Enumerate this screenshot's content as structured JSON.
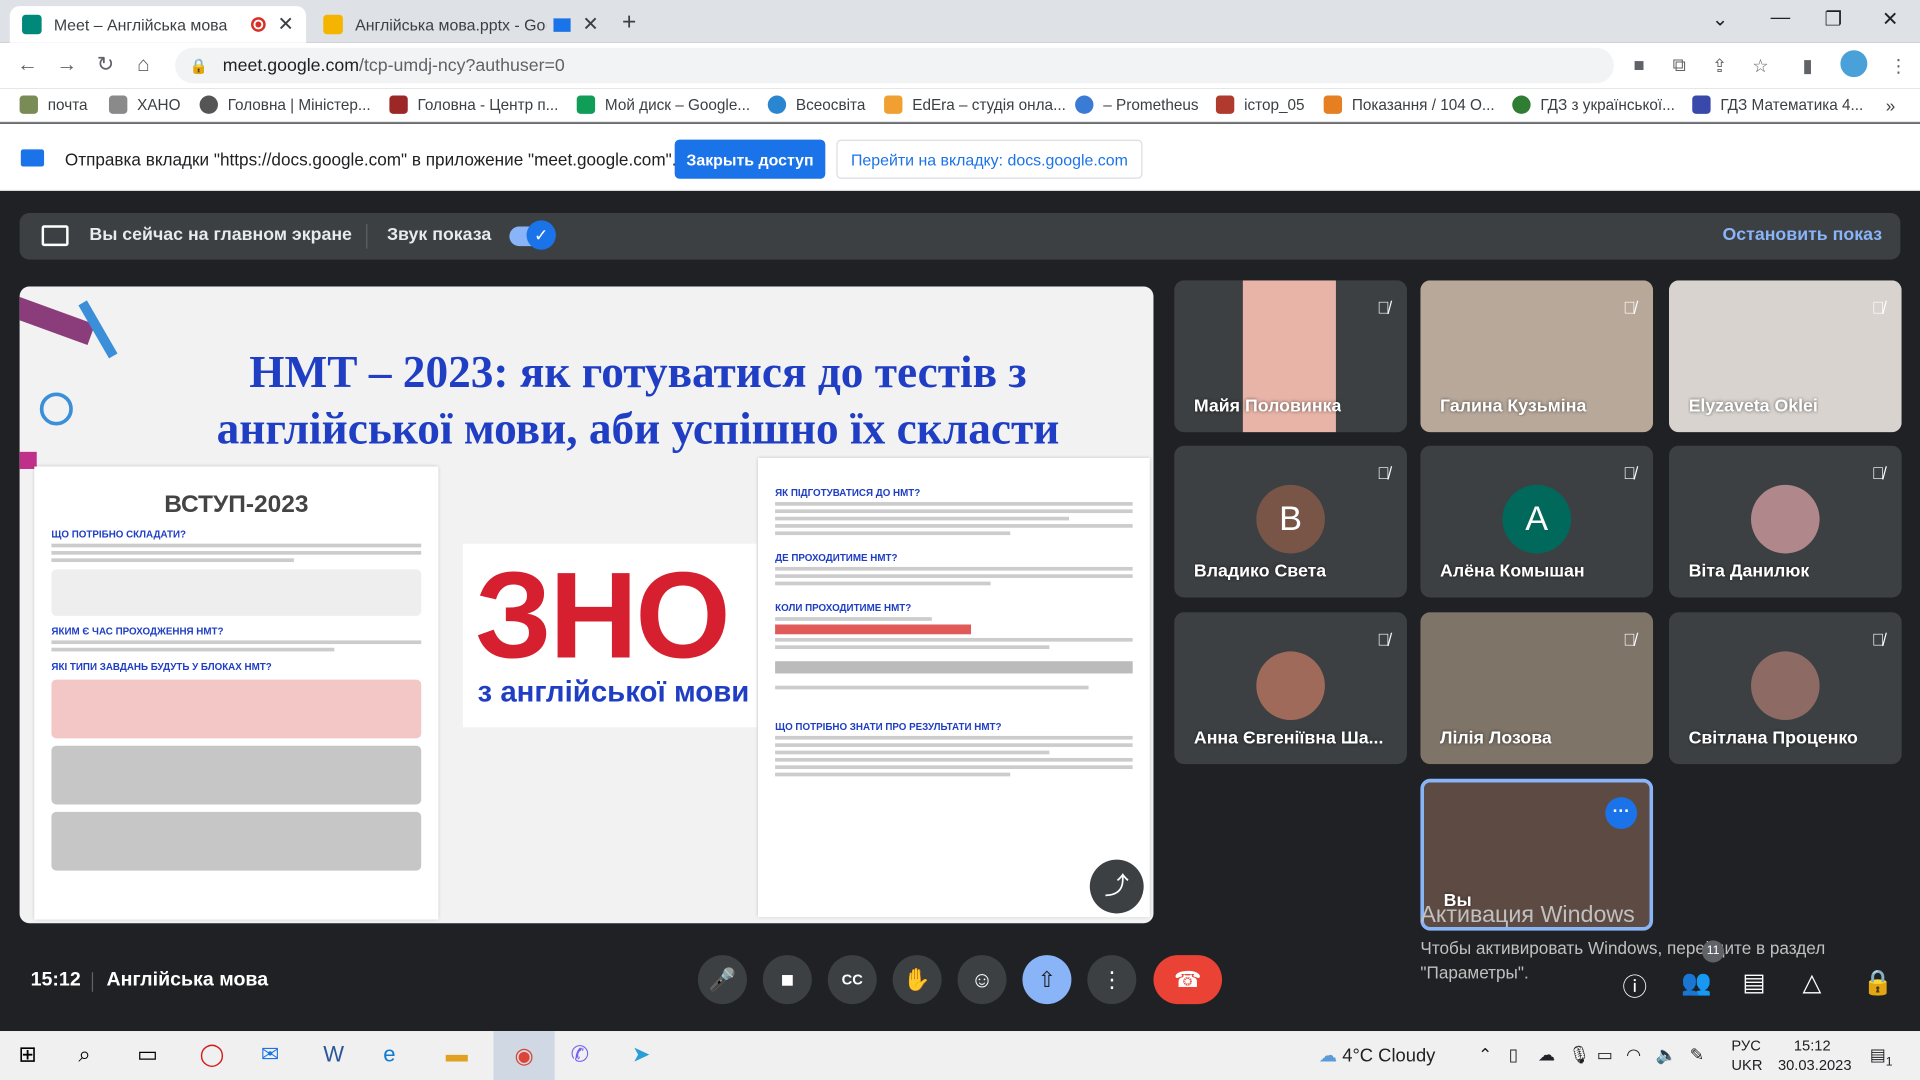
{
  "tabs": [
    {
      "title": "Meet – Англійська мова",
      "active": true,
      "favicon_color": "#00897b"
    },
    {
      "title": "Англійська мова.pptx - Goo",
      "active": false,
      "favicon_color": "#f4b400"
    }
  ],
  "address": {
    "host": "meet.google.com",
    "path": "/tcp-umdj-ncy?authuser=0"
  },
  "bookmarks": [
    {
      "label": "почта",
      "color": "#7a8c56"
    },
    {
      "label": "ХАНО",
      "color": "#8a8a8a"
    },
    {
      "label": "Головна | Міністер...",
      "color": "#555555"
    },
    {
      "label": "Головна - Центр п...",
      "color": "#9c2727"
    },
    {
      "label": "Мой диск – Google...",
      "color": "#0f9d58"
    },
    {
      "label": "Всеосвіта",
      "color": "#2a86d1"
    },
    {
      "label": "EdEra – студія онла...",
      "color": "#f0a030"
    },
    {
      "label": "– Prometheus",
      "color": "#3a7bd5"
    },
    {
      "label": "істор_05",
      "color": "#b03a2e"
    },
    {
      "label": "Показання / 104 О...",
      "color": "#e67e22"
    },
    {
      "label": "ГДЗ з української...",
      "color": "#2e7d32"
    },
    {
      "label": "ГДЗ Математика 4...",
      "color": "#3949ab"
    }
  ],
  "banner": {
    "text": "Отправка вкладки \"https://docs.google.com\" в приложение \"meet.google.com\"...",
    "close_access": "Закрыть доступ",
    "goto_tab": "Перейти на вкладку: docs.google.com"
  },
  "presenting_bar": {
    "status": "Вы сейчас на главном экране",
    "audio_label": "Звук показа",
    "stop": "Остановить показ"
  },
  "slide": {
    "title_line1": "НМТ – 2023: як готуватися до тестів з",
    "title_line2": "англійської мови, аби успішно їх скласти",
    "left_heading": "ВСТУП-2023",
    "left_sections": [
      "ЩО ПОТРІБНО СКЛАДАТИ?",
      "ЯКИМ Є ЧАС ПРОХОДЖЕННЯ НМТ?",
      "ЯКІ ТИПИ ЗАВДАНЬ БУДУТЬ У БЛОКАХ НМТ?"
    ],
    "right_sections": [
      "ЯК ПІДГОТУВАТИСЯ ДО НМТ?",
      "ДЕ ПРОХОДИТИМЕ НМТ?",
      "КОЛИ ПРОХОДИТИМЕ НМТ?",
      "ЩО ПОТРІБНО ЗНАТИ ПРО РЕЗУЛЬТАТИ НМТ?"
    ],
    "zno_z": "З",
    "zno_rest": "НО",
    "zno_sub": "з англійської мови"
  },
  "participants": [
    {
      "name": "Майя Половинка",
      "type": "video",
      "color": "#e8b4a8"
    },
    {
      "name": "Галина Кузьміна",
      "type": "video",
      "color": "#b7a89a"
    },
    {
      "name": "Elyzaveta Oklei",
      "type": "video",
      "color": "#d8d3cf"
    },
    {
      "name": "Владико Света",
      "type": "avatar",
      "initial": "В",
      "color": "#795548"
    },
    {
      "name": "Алёна Комышан",
      "type": "avatar",
      "initial": "А",
      "color": "#00695c"
    },
    {
      "name": "Віта Данилюк",
      "type": "photo",
      "color": "#b0878a"
    },
    {
      "name": "Анна Євгеніївна Ша...",
      "type": "photo",
      "color": "#a06a5a"
    },
    {
      "name": "Лілія Лозова",
      "type": "video",
      "color": "#7e7468"
    },
    {
      "name": "Світлана Проценко",
      "type": "photo",
      "color": "#8d6a63"
    }
  ],
  "self_tile": {
    "name": "Вы",
    "color": "#5d4a42"
  },
  "windows_watermark": {
    "title": "Активация Windows",
    "line1": "Чтобы активировать Windows, перейдите в раздел",
    "line2": "\"Параметры\"."
  },
  "meeting": {
    "time": "15:12",
    "title": "Англійська мова",
    "participants_count": "11"
  },
  "taskbar": {
    "weather": "4°C  Cloudy",
    "lang_top": "РУС",
    "lang_bottom": "UKR",
    "time": "15:12",
    "date": "30.03.2023",
    "notifications": "1"
  }
}
